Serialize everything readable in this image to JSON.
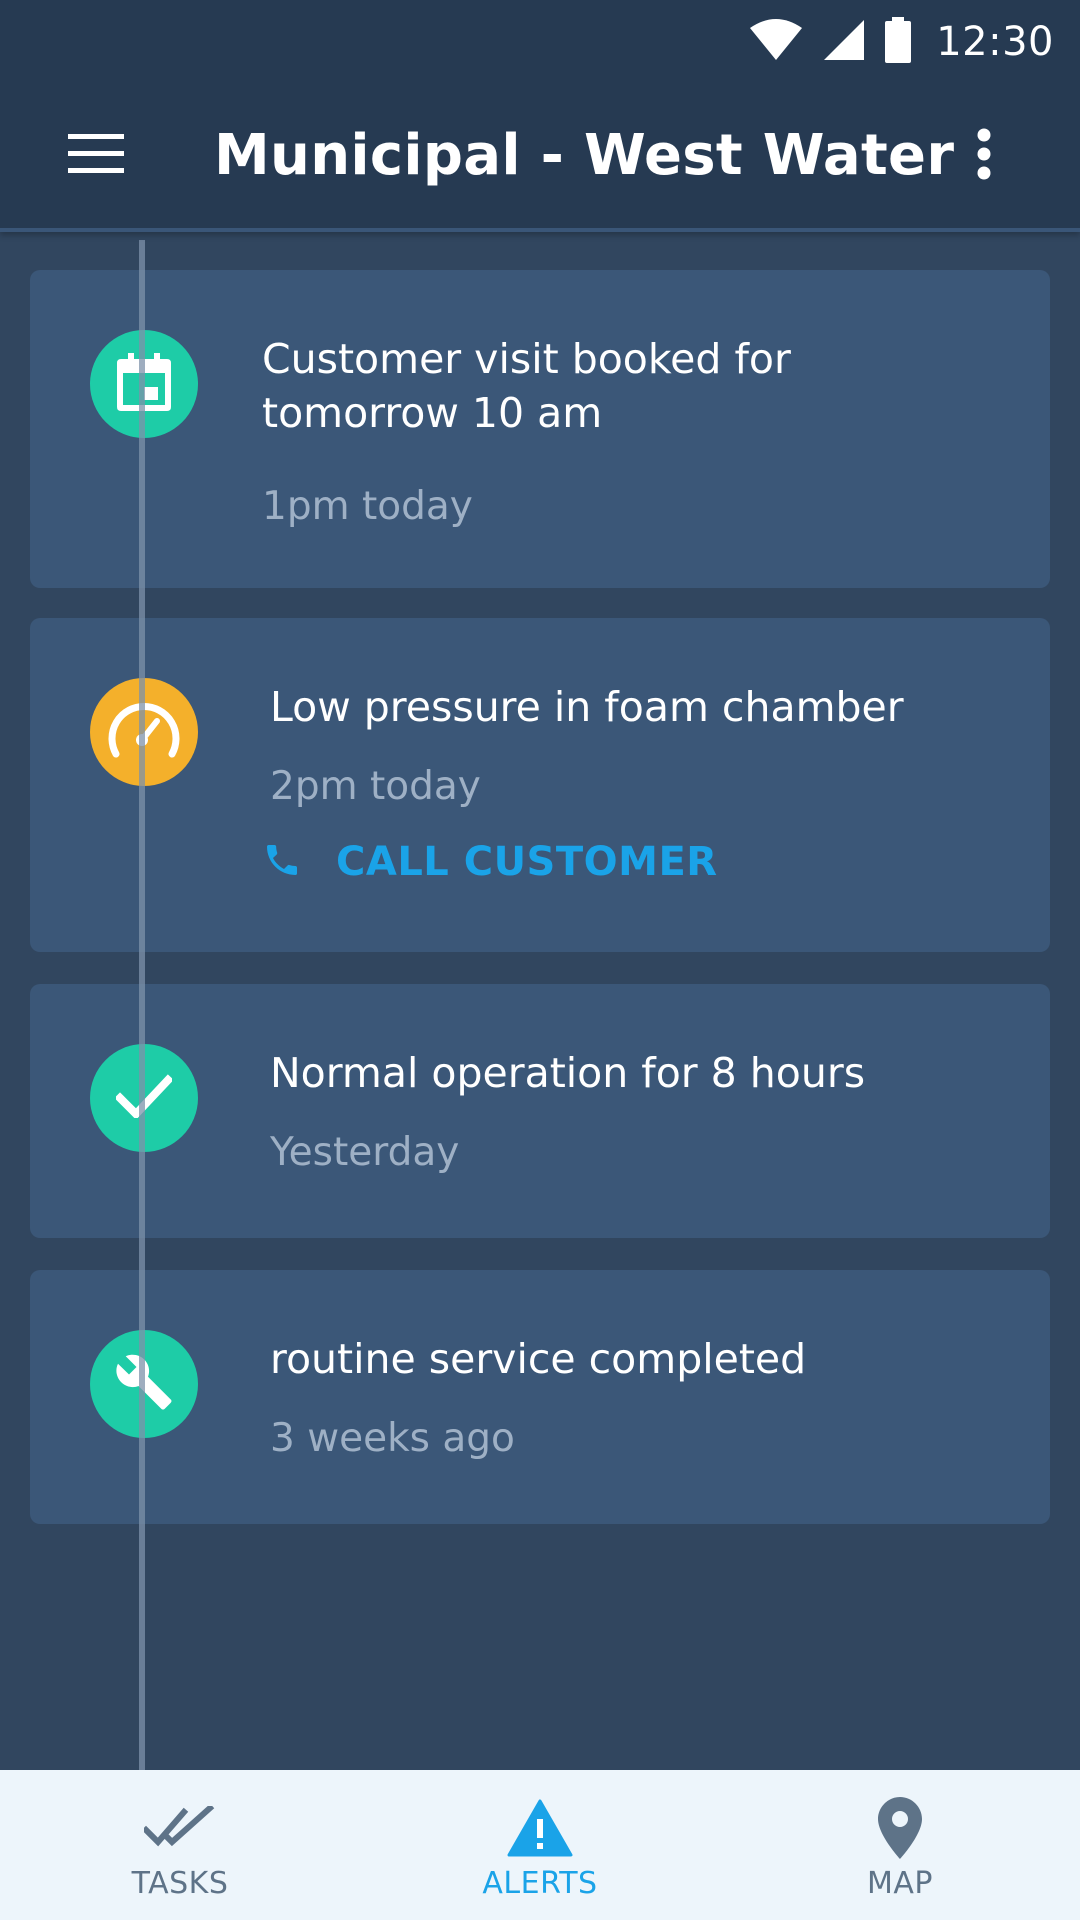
{
  "status_bar": {
    "time": "12:30",
    "icons": [
      "wifi-icon",
      "cellular-signal-icon",
      "battery-icon"
    ]
  },
  "toolbar": {
    "title": "Municipal - West Water",
    "menu_icon": "hamburger-menu-icon",
    "overflow_icon": "more-vertical-icon"
  },
  "timeline": {
    "items": [
      {
        "icon": "calendar-icon",
        "icon_color": "#1ecca7",
        "title_line1": "Customer visit booked for",
        "title_line2": "tomorrow 10 am",
        "time": "1pm today"
      },
      {
        "icon": "speedometer-icon",
        "icon_color": "#f4b02b",
        "title": "Low pressure in foam chamber",
        "time": "2pm today",
        "action_icon": "phone-icon",
        "action_label": "CALL CUSTOMER"
      },
      {
        "icon": "checkmark-icon",
        "icon_color": "#1ecca7",
        "title": "Normal operation for 8 hours",
        "time": "Yesterday"
      },
      {
        "icon": "wrench-icon",
        "icon_color": "#1ecca7",
        "title": "routine service completed",
        "time": "3 weeks ago"
      }
    ]
  },
  "bottom_nav": {
    "active": "ALERTS",
    "items": [
      {
        "label": "TASKS",
        "icon": "double-check-icon"
      },
      {
        "label": "ALERTS",
        "icon": "warning-triangle-icon"
      },
      {
        "label": "MAP",
        "icon": "map-pin-icon"
      }
    ]
  },
  "colors": {
    "app_bar": "#263a52",
    "background": "#31465f",
    "card": "#3b5778",
    "accent_teal": "#1ecca7",
    "accent_amber": "#f4b02b",
    "link_blue": "#1aa3e8",
    "secondary_text": "#9eb0c5",
    "nav_background": "#edf5fb"
  }
}
